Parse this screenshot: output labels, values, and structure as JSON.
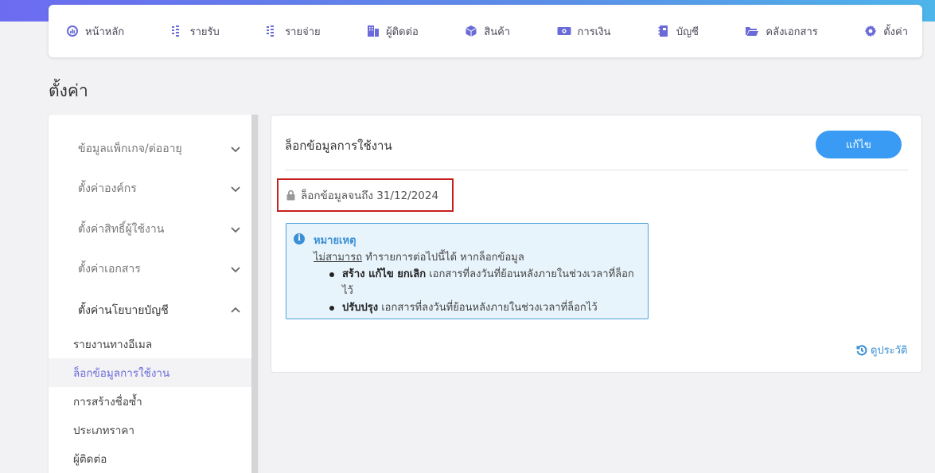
{
  "nav": {
    "items": [
      {
        "label": "หน้าหลัก",
        "icon": "dashboard-icon"
      },
      {
        "label": "รายรับ",
        "icon": "income-icon"
      },
      {
        "label": "รายจ่าย",
        "icon": "expense-icon"
      },
      {
        "label": "ผู้ติดต่อ",
        "icon": "contacts-icon"
      },
      {
        "label": "สินค้า",
        "icon": "box-icon"
      },
      {
        "label": "การเงิน",
        "icon": "money-icon"
      },
      {
        "label": "บัญชี",
        "icon": "ledger-icon"
      },
      {
        "label": "คลังเอกสาร",
        "icon": "folder-icon"
      },
      {
        "label": "ตั้งค่า",
        "icon": "gear-icon"
      }
    ]
  },
  "page": {
    "title": "ตั้งค่า"
  },
  "sidebar": {
    "sections": [
      {
        "label": "ข้อมูลแพ็กเกจ/ต่ออายุ",
        "expanded": false
      },
      {
        "label": "ตั้งค่าองค์กร",
        "expanded": false
      },
      {
        "label": "ตั้งค่าสิทธิ์ผู้ใช้งาน",
        "expanded": false
      },
      {
        "label": "ตั้งค่าเอกสาร",
        "expanded": false
      },
      {
        "label": "ตั้งค่านโยบายบัญชี",
        "expanded": true
      }
    ],
    "sub_items": [
      {
        "label": "รายงานทางอีเมล"
      },
      {
        "label": "ล็อกข้อมูลการใช้งาน",
        "active": true
      },
      {
        "label": "การสร้างชื่อซ้ำ"
      },
      {
        "label": "ประเภทราคา"
      },
      {
        "label": "ผู้ติดต่อ"
      }
    ]
  },
  "content": {
    "title": "ล็อกข้อมูลการใช้งาน",
    "edit_label": "แก้ไข",
    "lock_text": "ล็อกข้อมูลจนถึง 31/12/2024",
    "note": {
      "title": "หมายเหตุ",
      "line_underlined": "ไม่สามารถ",
      "line_rest": " ทำรายการต่อไปนี้ได้ หากล็อกข้อมูล",
      "bullets": [
        {
          "bold": "สร้าง แก้ไข ยกเลิก",
          "rest": " เอกสารที่ลงวันที่ย้อนหลังภายในช่วงเวลาที่ล็อกไว้"
        },
        {
          "bold": "ปรับปรุง",
          "rest": " เอกสารที่ลงวันที่ย้อนหลังภายในช่วงเวลาที่ล็อกไว้"
        }
      ]
    },
    "history_label": "ดูประวัติ"
  },
  "colors": {
    "accent": "#6a6ad8",
    "button": "#3a9bf4",
    "highlight_border": "#c81e1e",
    "info": "#3a8fd6"
  }
}
